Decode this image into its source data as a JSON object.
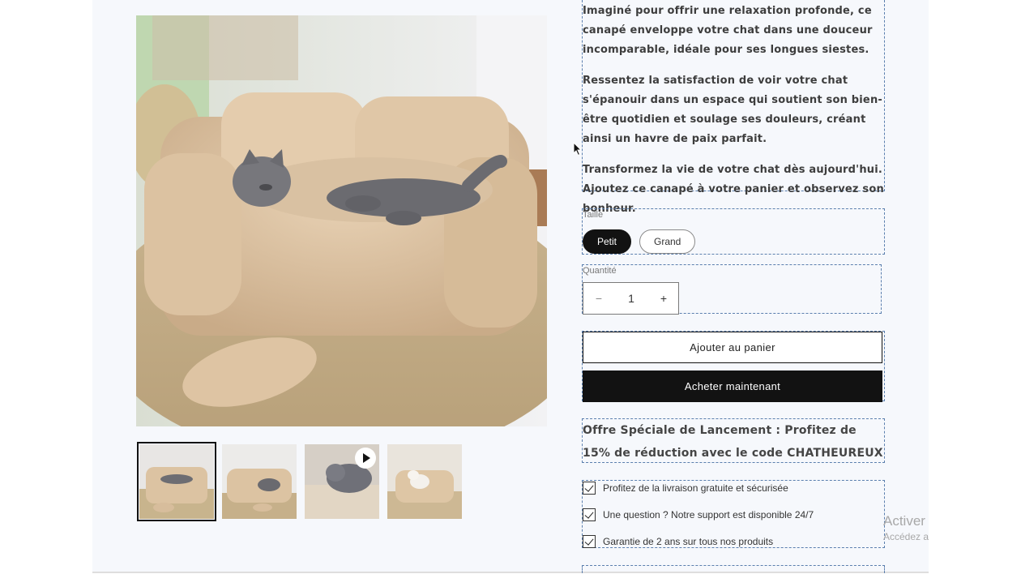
{
  "gallery": {
    "main_image_alt": "",
    "thumbnails": [
      {
        "name": "thumb-1",
        "active": true,
        "video": false
      },
      {
        "name": "thumb-2",
        "active": false,
        "video": false
      },
      {
        "name": "thumb-3",
        "active": false,
        "video": true
      },
      {
        "name": "thumb-4",
        "active": false,
        "video": false
      }
    ]
  },
  "description": {
    "paragraphs": [
      "Imaginé pour offrir une relaxation profonde, ce canapé enveloppe votre chat dans une douceur incomparable, idéale pour ses longues siestes.",
      "Ressentez la satisfaction de voir votre chat s'épanouir dans un espace qui soutient son bien-être quotidien et soulage ses douleurs, créant ainsi un havre de paix parfait.",
      "Transformez la vie de votre chat dès aujourd'hui. Ajoutez ce canapé à votre panier et observez son bonheur."
    ]
  },
  "size": {
    "label": "Taille",
    "options": [
      "Petit",
      "Grand"
    ],
    "selected": "Petit"
  },
  "quantity": {
    "label": "Quantité",
    "value": "1",
    "minus": "−",
    "plus": "+"
  },
  "buttons": {
    "add_to_cart": "Ajouter au panier",
    "buy_now": "Acheter maintenant"
  },
  "offer": {
    "text": "Offre Spéciale de Lancement : Profitez de 15% de réduction avec le code CHATHEUREUX"
  },
  "benefits": [
    "Profitez de la livraison gratuite et sécurisée",
    "Une question ? Notre support est disponible 24/7",
    "Garantie de 2 ans sur tous nos produits"
  ],
  "watermark": {
    "title": "Activer Windows",
    "subtitle": "Accédez aux paramètres"
  },
  "colors": {
    "page_bg": "#f6f8fc",
    "primary": "#121212",
    "outline_dash": "#5b7fae"
  }
}
